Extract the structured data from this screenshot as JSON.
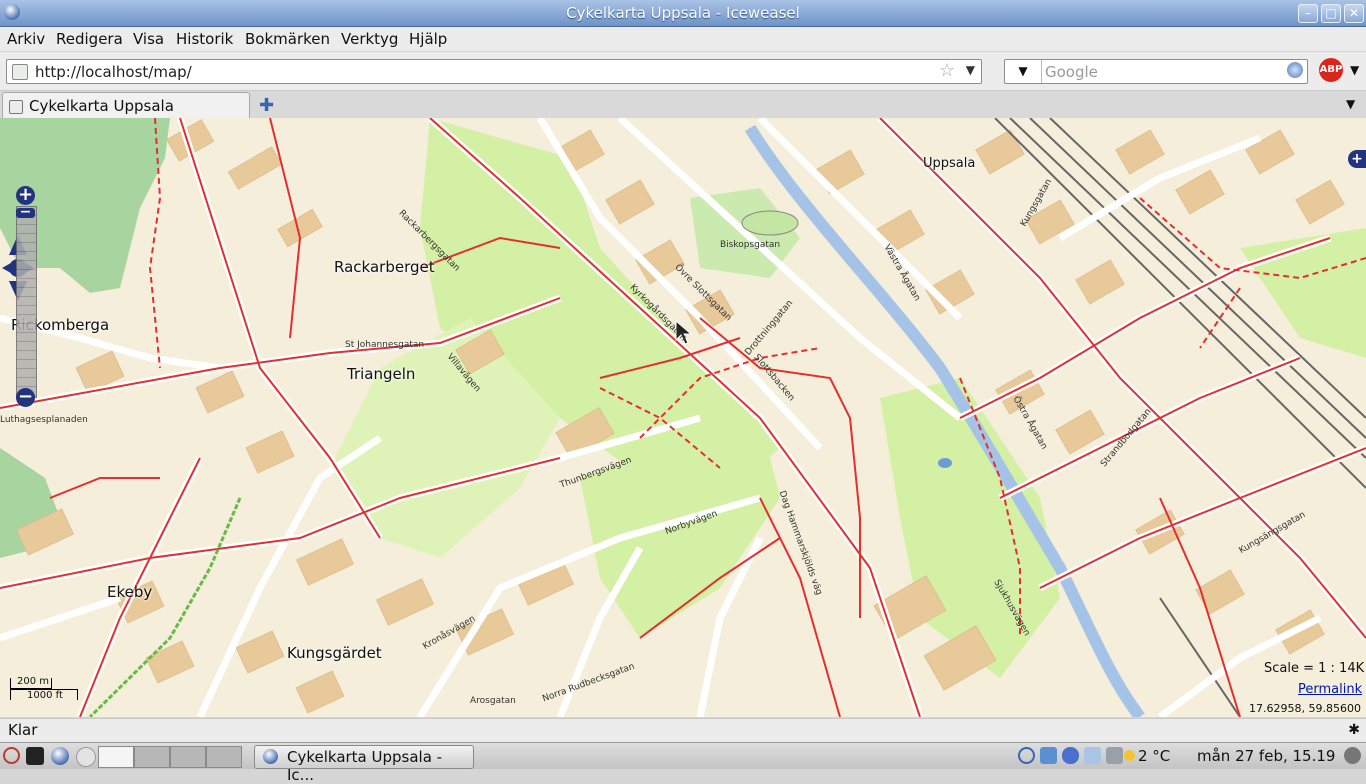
{
  "window": {
    "title": "Cykelkarta Uppsala - Iceweasel"
  },
  "menu": [
    "Arkiv",
    "Redigera",
    "Visa",
    "Historik",
    "Bokmärken",
    "Verktyg",
    "Hjälp"
  ],
  "nav": {
    "url": "http://localhost/map/",
    "search_placeholder": "Google",
    "adblock_label": "ABP"
  },
  "tabs": [
    {
      "label": "Cykelkarta Uppsala"
    }
  ],
  "map": {
    "places": [
      "Rackarberget",
      "Rickomberga",
      "Triangeln",
      "Ekeby",
      "Kungsgärdet",
      "Uppsala"
    ],
    "streets": [
      "Luthagsesplanaden",
      "St Johannesgatan",
      "Thunbergsvägen",
      "Norbyvägen",
      "Dag Hammarskjölds väg",
      "Kungsgatan",
      "Östra Ågatan",
      "Västra Ågatan",
      "Villavägen",
      "Slottsbacken",
      "Drottninggatan",
      "Kyrkogårdsgatan",
      "Övre Slottsgatan",
      "Biskopsgatan",
      "Sjukhusvägen",
      "Strandbodgatan",
      "Kungsängsgatan",
      "Rackarbergsgatan",
      "Kronåsvägen",
      "Norra Rudbecksgatan",
      "Arosgatan"
    ],
    "scale_m": "200 m",
    "scale_ft": "1000 ft",
    "scale_text": "Scale = 1 : 14K",
    "permalink": "Permalink",
    "coords": "17.62958, 59.85600"
  },
  "status": {
    "text": "Klar"
  },
  "taskbar": {
    "task_label": "Cykelkarta Uppsala - Ic...",
    "temperature": "2 °C",
    "clock": "mån 27 feb, 15.19"
  },
  "colors": {
    "bike_route": "#e03030",
    "park": "#d4f0a4",
    "building": "#e8c99a",
    "water": "#a5c3e6",
    "titlebar": "#7f9fd0"
  }
}
